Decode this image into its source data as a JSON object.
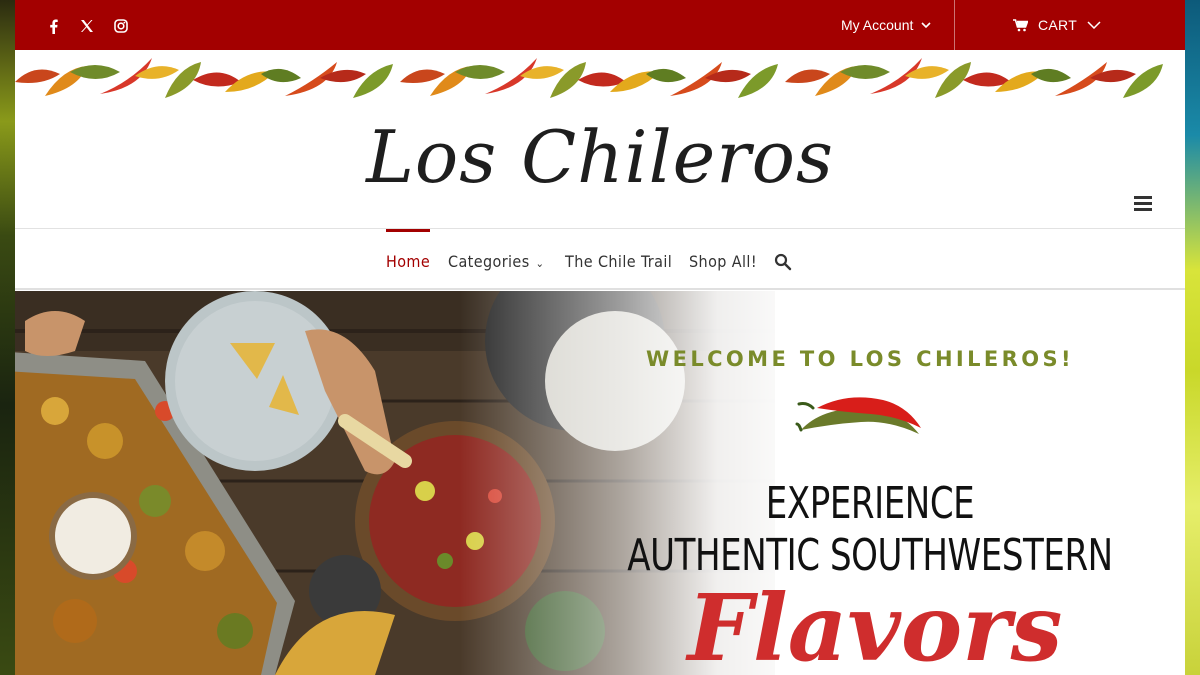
{
  "colors": {
    "brand_red": "#a30000",
    "accent_olive": "#7a8b2a",
    "flavors_red": "#cf2d2d"
  },
  "topbar": {
    "social": [
      {
        "name": "facebook-icon",
        "glyph": "f"
      },
      {
        "name": "x-icon",
        "glyph": "𝕏"
      },
      {
        "name": "instagram-icon",
        "glyph": "◎"
      }
    ],
    "account_label": "My Account",
    "cart_label": "CART"
  },
  "logo": {
    "text": "Los Chileros"
  },
  "nav": {
    "home": "Home",
    "categories": "Categories",
    "chile_trail": "The Chile Trail",
    "shop_all": "Shop All!"
  },
  "hero": {
    "welcome": "WELCOME TO LOS CHILEROS!",
    "line1": "EXPERIENCE",
    "line2": "AUTHENTIC SOUTHWESTERN",
    "line3": "Flavors"
  }
}
